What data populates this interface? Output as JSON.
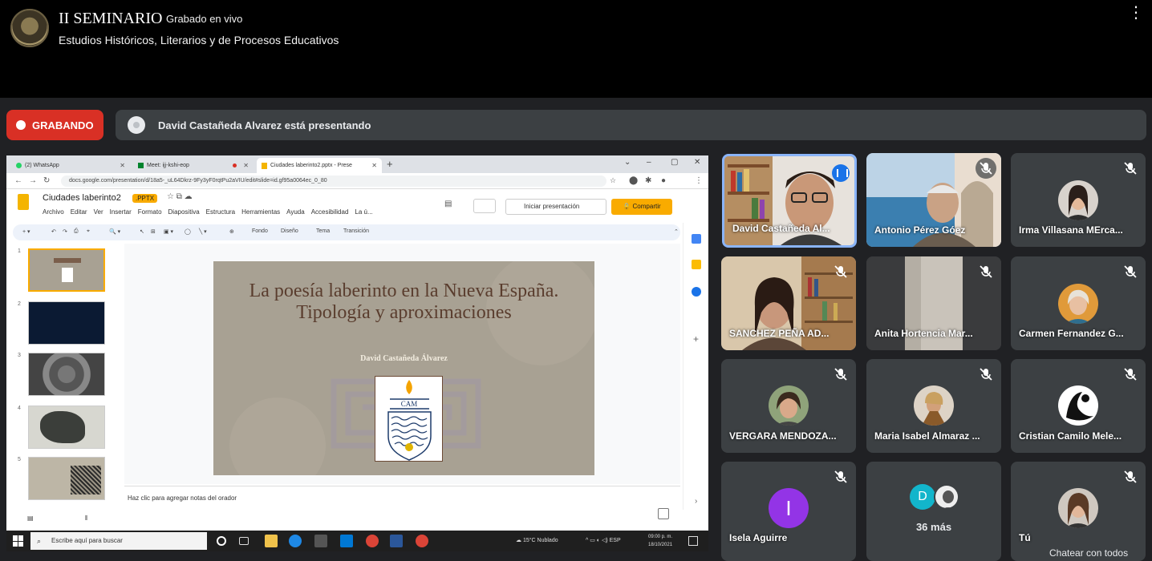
{
  "header": {
    "title": "II SEMINARIO",
    "live_label": "Grabado en vivo",
    "subtitle": "Estudios Históricos, Literarios y de Procesos Educativos",
    "more_icon": "⋮"
  },
  "meeting": {
    "recording_label": "GRABANDO",
    "presenting_label": "David Castañeda Alvarez está presentando",
    "tiles": [
      {
        "name": "David Castañeda Al...",
        "speaking": true
      },
      {
        "name": "Antonio Pérez Góez",
        "muted": true
      },
      {
        "name": "Irma Villasana MErca...",
        "muted": true
      },
      {
        "name": "SANCHEZ PEÑA AD...",
        "muted": true
      },
      {
        "name": "Anita Hortencia Mar...",
        "muted": true
      },
      {
        "name": "Carmen Fernandez G...",
        "muted": true
      },
      {
        "name": "VERGARA MENDOZA...",
        "muted": true
      },
      {
        "name": "Maria Isabel Almaraz ...",
        "muted": true
      },
      {
        "name": "Cristian Camilo Mele...",
        "muted": true
      },
      {
        "name": "Isela Aguirre",
        "muted": true,
        "avatar_letter": "I",
        "avatar_color": "#9334e6"
      },
      {
        "name": "36 más",
        "avatar_letter": "D",
        "avatar_color": "#12b5cb"
      },
      {
        "name": "Tú",
        "muted": true
      }
    ],
    "chat_label": "Chatear con todos"
  },
  "shared_screen": {
    "tabs": [
      {
        "label": "(2) WhatsApp"
      },
      {
        "label": "Meet: ijj-kshi-eop"
      },
      {
        "label": "Ciudades laberinto2.pptx - Prese"
      }
    ],
    "url": "docs.google.com/presentation/d/18a5-_uL64Dkrz-9Fy3yF0rqtPu2aVIU/edit#slide=id.gf95a0064ec_0_80",
    "doc_title": "Ciudades laberinto2",
    "doc_badge": ".PPTX",
    "menu": [
      "Archivo",
      "Editar",
      "Ver",
      "Insertar",
      "Formato",
      "Diapositiva",
      "Estructura",
      "Herramientas",
      "Ayuda",
      "Accesibilidad",
      "La ú..."
    ],
    "present_label": "Iniciar presentación",
    "share_label": "Compartir",
    "toolbar": {
      "fondo": "Fondo",
      "diseno": "Diseño",
      "tema": "Tema",
      "transicion": "Transición"
    },
    "slide": {
      "title": "La poesía laberinto en la Nueva España. Tipología y aproximaciones",
      "author": "David Castañeda Álvarez",
      "crest_text": "CAM"
    },
    "slide_numbers": [
      "1",
      "2",
      "3",
      "4",
      "5"
    ],
    "notes_placeholder": "Haz clic para agregar notas del orador",
    "taskbar": {
      "search_placeholder": "Escribe aquí para buscar",
      "weather": "15°C  Nublado",
      "lang": "ESP",
      "time": "09:00 p. m.",
      "date": "18/10/2021"
    }
  }
}
